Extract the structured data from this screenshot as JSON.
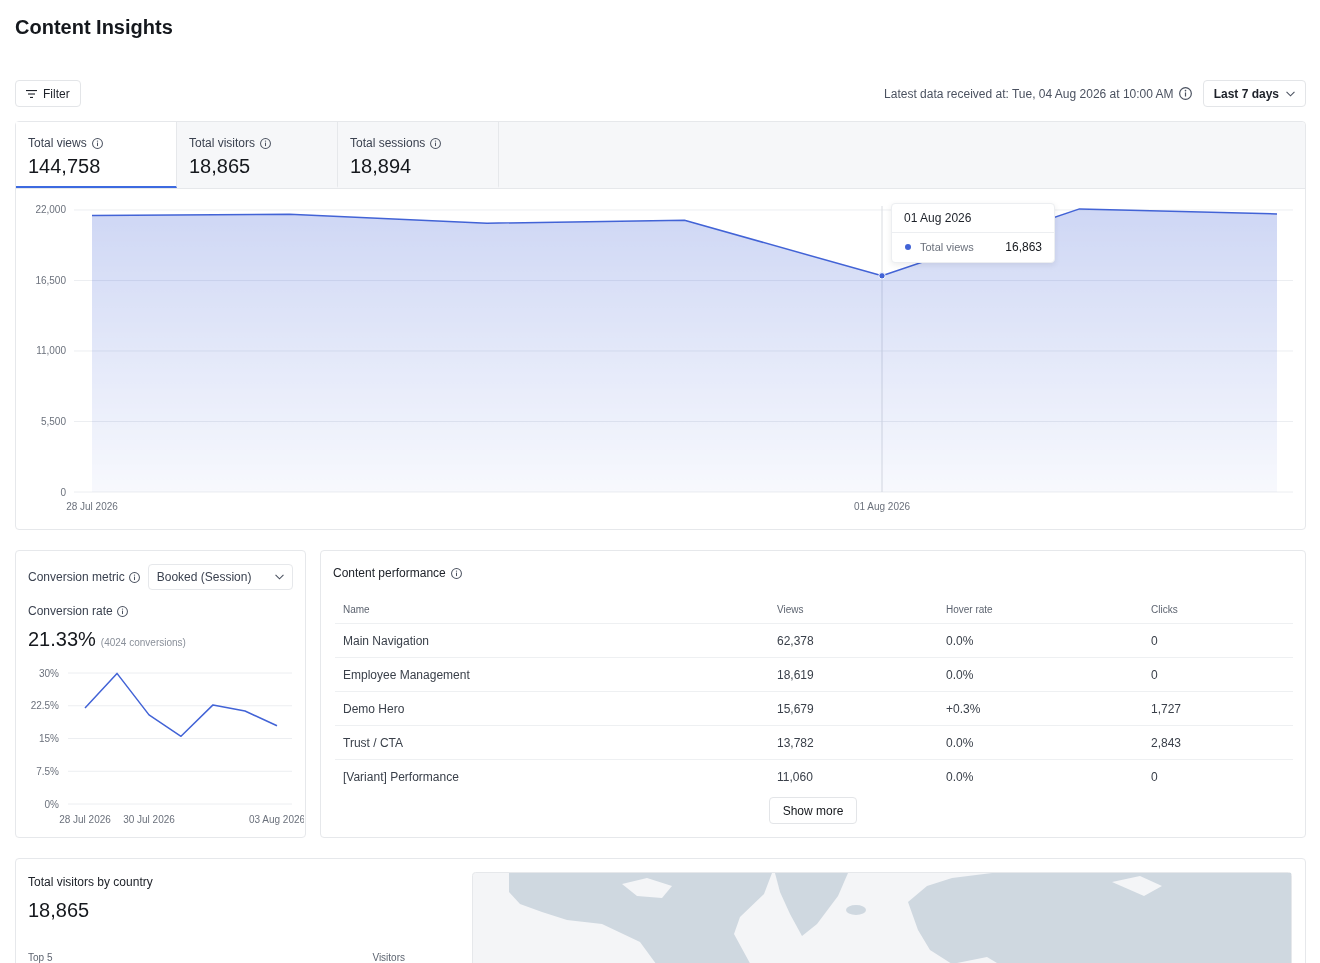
{
  "page": {
    "title": "Content Insights"
  },
  "toolbar": {
    "filter_button": "Filter",
    "latest_data": "Latest data received at: Tue, 04 Aug 2026 at 10:00 AM",
    "range_button": "Last 7 days"
  },
  "metric_tabs": [
    {
      "label": "Total views",
      "value": "144,758",
      "selected": true
    },
    {
      "label": "Total visitors",
      "value": "18,865",
      "selected": false
    },
    {
      "label": "Total sessions",
      "value": "18,894",
      "selected": false
    }
  ],
  "views_chart": {
    "chart_data": {
      "type": "area",
      "grid": true,
      "categories": [
        "28 Jul 2026",
        null,
        null,
        null,
        "01 Aug 2026",
        null,
        null
      ],
      "ylim": [
        0,
        22200
      ],
      "yticks": [
        {
          "value": 0,
          "label": "0"
        },
        {
          "value": 5500,
          "label": "5,500"
        },
        {
          "value": 11000,
          "label": "11,000"
        },
        {
          "value": 16500,
          "label": "16,500"
        },
        {
          "value": 22000,
          "label": "22,000"
        }
      ],
      "series": [
        {
          "name": "Total views",
          "color": "#4263d6",
          "values": [
            21560,
            21670,
            20970,
            21190,
            16863,
            22080,
            21690
          ]
        }
      ],
      "annotations": [
        "16,863"
      ]
    },
    "tooltip_date": "01 Aug 2026"
  },
  "conversion": {
    "metric_label": "Conversion metric",
    "metric_value": "Booked (Session)",
    "rate_label": "Conversion rate",
    "rate": "21.33%",
    "conversions": "(4024 conversions)",
    "chart_data": {
      "type": "line",
      "grid": true,
      "categories": [
        "28 Jul 2026",
        null,
        "30 Jul 2026",
        null,
        null,
        null,
        "03 Aug 2026"
      ],
      "ylim": [
        0,
        30
      ],
      "yticks": [
        {
          "value": 0,
          "label": "0%"
        },
        {
          "value": 7.5,
          "label": "7.5%"
        },
        {
          "value": 15,
          "label": "15%"
        },
        {
          "value": 22.5,
          "label": "22.5%"
        },
        {
          "value": 30,
          "label": "30%"
        }
      ],
      "series": [
        {
          "color": "#4263d6",
          "values": [
            22,
            29.9,
            20.4,
            15.5,
            22.7,
            21.3,
            17.9
          ]
        }
      ]
    }
  },
  "content_performance": {
    "title": "Content performance",
    "columns": [
      "Name",
      "Views",
      "Hover rate",
      "Clicks"
    ],
    "rows": [
      [
        "Main Navigation",
        "62,378",
        "0.0%",
        "0"
      ],
      [
        "Employee Management",
        "18,619",
        "0.0%",
        "0"
      ],
      [
        "Demo Hero",
        "15,679",
        "+0.3%",
        "1,727"
      ],
      [
        "Trust / CTA",
        "13,782",
        "0.0%",
        "2,843"
      ],
      [
        "[Variant] Performance",
        "11,060",
        "0.0%",
        "0"
      ]
    ],
    "show_more": "Show more"
  },
  "visitors_by_country": {
    "title": "Total visitors by country",
    "total": "18,865",
    "columns": [
      "Top 5",
      "Visitors"
    ]
  }
}
